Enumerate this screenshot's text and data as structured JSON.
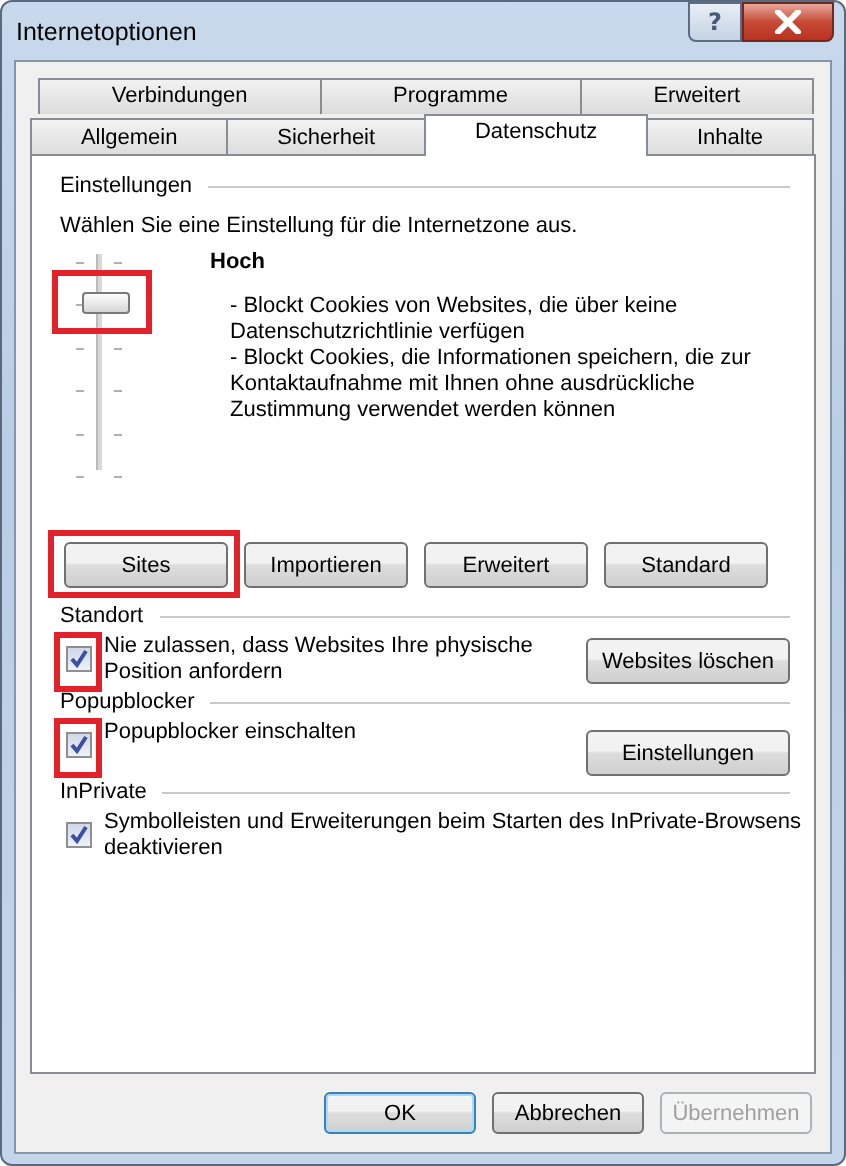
{
  "window": {
    "title": "Internetoptionen",
    "help_glyph": "?"
  },
  "tabs": [
    [
      {
        "label": "Verbindungen",
        "selected": false
      },
      {
        "label": "Programme",
        "selected": false
      },
      {
        "label": "Erweitert",
        "selected": false
      }
    ],
    [
      {
        "label": "Allgemein",
        "selected": false
      },
      {
        "label": "Sicherheit",
        "selected": false
      },
      {
        "label": "Datenschutz",
        "selected": true
      },
      {
        "label": "Inhalte",
        "selected": false
      }
    ]
  ],
  "settings": {
    "heading": "Einstellungen",
    "intro": "Wählen Sie eine Einstellung für die Internetzone aus.",
    "slider": {
      "level": 0.8,
      "highlighted": true
    },
    "level_name": "Hoch",
    "description": [
      "- Blockt Cookies von Websites, die über keine Datenschutzrichtlinie verfügen",
      "- Blockt Cookies, die Informationen speichern, die zur Kontaktaufnahme mit Ihnen ohne ausdrückliche Zustimmung verwendet werden können"
    ],
    "buttons": [
      {
        "label": "Sites",
        "highlighted": true
      },
      {
        "label": "Importieren",
        "highlighted": false
      },
      {
        "label": "Erweitert",
        "highlighted": false
      },
      {
        "label": "Standard",
        "highlighted": false
      }
    ]
  },
  "sections": [
    {
      "heading": "Standort",
      "checkbox": {
        "label": "Nie zulassen, dass Websites Ihre physische Position anfordern",
        "checked": true,
        "highlighted": true
      },
      "button": "Websites löschen"
    },
    {
      "heading": "Popupblocker",
      "checkbox": {
        "label": "Popupblocker einschalten",
        "checked": true,
        "highlighted": true
      },
      "button": "Einstellungen"
    },
    {
      "heading": "InPrivate",
      "checkbox": {
        "label": "Symbolleisten und Erweiterungen beim Starten des InPrivate-Browsens deaktivieren",
        "checked": true,
        "highlighted": false
      }
    }
  ],
  "footer_buttons": [
    {
      "label": "OK",
      "default": true,
      "disabled": false
    },
    {
      "label": "Abbrechen",
      "default": false,
      "disabled": false
    },
    {
      "label": "Übernehmen",
      "default": false,
      "disabled": true
    }
  ]
}
